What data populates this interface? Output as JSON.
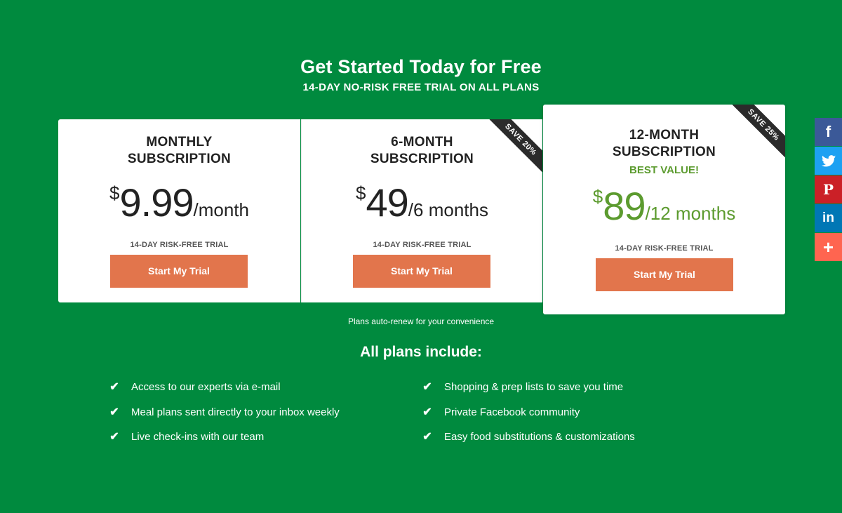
{
  "hero": {
    "title": "Get Started Today for Free",
    "subtitle": "14-DAY NO-RISK FREE TRIAL ON ALL PLANS"
  },
  "plans": [
    {
      "name_line1": "MONTHLY",
      "name_line2": "SUBSCRIPTION",
      "currency": "$",
      "amount": "9.99",
      "period": "/month",
      "trial_label": "14-DAY RISK-FREE TRIAL",
      "cta": "Start My Trial"
    },
    {
      "name_line1": "6-MONTH",
      "name_line2": "SUBSCRIPTION",
      "currency": "$",
      "amount": "49",
      "period": "/6 months",
      "trial_label": "14-DAY RISK-FREE TRIAL",
      "cta": "Start My Trial",
      "ribbon": "SAVE 20%"
    },
    {
      "name_line1": "12-MONTH",
      "name_line2": "SUBSCRIPTION",
      "badge": "BEST VALUE!",
      "currency": "$",
      "amount": "89",
      "period": "/12 months",
      "trial_label": "14-DAY RISK-FREE TRIAL",
      "cta": "Start My Trial",
      "ribbon": "SAVE 25%"
    }
  ],
  "auto_renew_note": "Plans auto-renew for your convenience",
  "includes": {
    "title": "All plans include:",
    "features": [
      "Access to our experts via e-mail",
      "Meal plans sent directly to your inbox weekly",
      "Live check-ins with our team",
      "Shopping & prep lists to save you time",
      "Private Facebook community",
      "Easy food substitutions & customizations"
    ],
    "check_icon": "check-icon"
  },
  "share": {
    "facebook": "f",
    "pinterest": "P",
    "linkedin": "in",
    "more": "+"
  },
  "colors": {
    "background": "#008a3e",
    "accent_green": "#5c9b2f",
    "cta": "#e2754c",
    "ribbon": "#2b2b2b",
    "facebook": "#3b5998",
    "twitter": "#1da1f2",
    "pinterest": "#cb2027",
    "linkedin": "#0077b5",
    "more": "#ff6550"
  }
}
